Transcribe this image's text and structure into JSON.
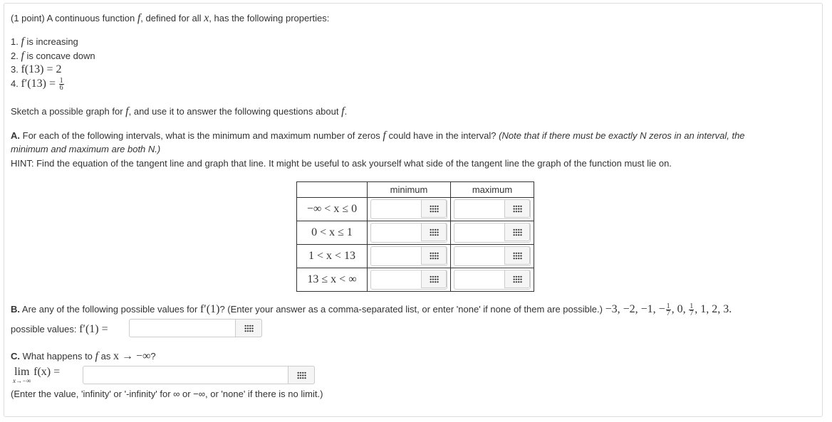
{
  "header": {
    "points": "(1 point)",
    "intro": "A continuous function",
    "fsym": "f",
    "defined": ", defined for all",
    "xsym": "x",
    "tail": ", has the following properties:"
  },
  "properties": [
    {
      "num": "1.",
      "f": "f",
      "text": " is increasing"
    },
    {
      "num": "2.",
      "f": "f",
      "text": " is concave down"
    },
    {
      "num": "3.",
      "math": "f(13) = 2"
    },
    {
      "num": "4.",
      "math": "f′(13) =",
      "fnum": "1",
      "fden": "6"
    }
  ],
  "sketch": {
    "text": "Sketch a possible graph for",
    "fsym": "f",
    "mid": ", and use it to answer the following questions about",
    "fsym2": "f",
    "end": "."
  },
  "partA": {
    "label": "A.",
    "text": "For each of the following intervals, what is the minimum and maximum number of zeros",
    "fsym": "f",
    "text2": "could have in the interval?",
    "note1": "(Note that if there must be exactly N zeros in an interval, the",
    "note2": "minimum and maximum are both N.)",
    "hint": "HINT: Find the equation of the tangent line and graph that line. It might be useful to ask yourself what side of the tangent line the graph of the function must lie on.",
    "table": {
      "headers": [
        "",
        "minimum",
        "maximum"
      ],
      "rows": [
        {
          "interval": "−∞ < x ≤ 0",
          "min": "",
          "max": ""
        },
        {
          "interval": "0 < x ≤ 1",
          "min": "",
          "max": ""
        },
        {
          "interval": "1 < x < 13",
          "min": "",
          "max": ""
        },
        {
          "interval": "13 ≤ x < ∞",
          "min": "",
          "max": ""
        }
      ]
    }
  },
  "partB": {
    "label": "B.",
    "text": "Are any of the following possible values for",
    "expr": "f′(1)",
    "text2": "? (Enter your answer as a comma-separated list, or enter 'none' if none of them are possible.)",
    "vals": "−3, −2, −1, −",
    "vals_mid": ", 0,",
    "vals_end": ", 1, 2, 3.",
    "frac_num": "1",
    "frac_den": "7",
    "input_label": "possible values:",
    "input_expr": "f′(1) =",
    "input_value": ""
  },
  "partC": {
    "label": "C.",
    "text": "What happens to",
    "fsym": "f",
    "as": "as",
    "arrow": "x → −∞",
    "q": "?",
    "lim": "lim",
    "lim_sub": "x→−∞",
    "fx": "f(x) =",
    "input_value": "",
    "note": "(Enter the value, 'infinity' or '-infinity' for ∞ or −∞, or 'none' if there is no limit.)"
  }
}
